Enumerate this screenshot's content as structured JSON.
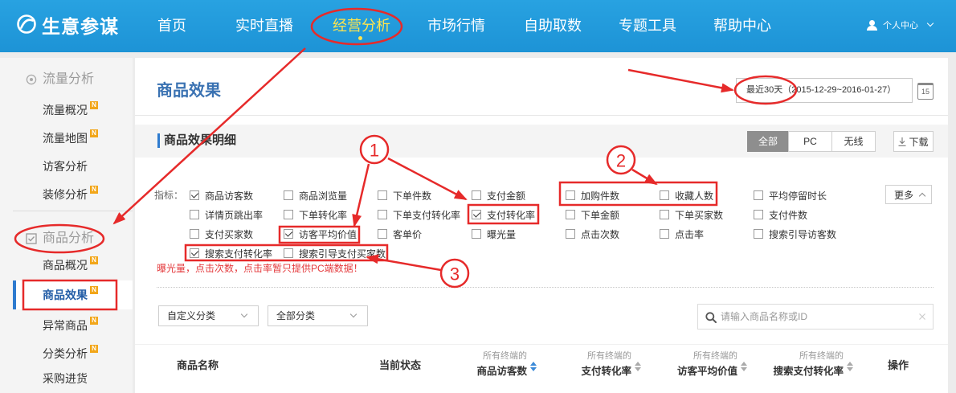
{
  "app": {
    "title": "生意参谋"
  },
  "nav": {
    "items": [
      {
        "label": "首页",
        "active": false
      },
      {
        "label": "实时直播",
        "active": false
      },
      {
        "label": "经营分析",
        "active": true
      },
      {
        "label": "市场行情",
        "active": false
      },
      {
        "label": "自助取数",
        "active": false
      },
      {
        "label": "专题工具",
        "active": false
      },
      {
        "label": "帮助中心",
        "active": false
      }
    ],
    "user_label": "个人中心",
    "icons": {
      "logo": "logo-icon",
      "user": "user-icon",
      "dropdown": "chevron-down-icon"
    }
  },
  "sidebar": {
    "sections": [
      {
        "title": "流量分析",
        "icon": "eye-icon",
        "items": [
          {
            "label": "流量概况",
            "badge": "N"
          },
          {
            "label": "流量地图",
            "badge": "N"
          },
          {
            "label": "访客分析"
          },
          {
            "label": "装修分析",
            "badge": "N"
          }
        ]
      },
      {
        "title": "商品分析",
        "icon": "checkbox-icon",
        "items": [
          {
            "label": "商品概况",
            "badge": "N"
          },
          {
            "label": "商品效果",
            "badge": "N",
            "active": true
          },
          {
            "label": "异常商品",
            "badge": "N"
          },
          {
            "label": "分类分析",
            "badge": "N"
          },
          {
            "label": "采购进货"
          }
        ]
      }
    ]
  },
  "main": {
    "title": "商品效果",
    "date_picker": {
      "preset": "最近30天",
      "range": "（2015-12-29~2016-01-27）",
      "calendar_day": "15"
    },
    "detail": {
      "title": "商品效果明细",
      "device_tabs": [
        {
          "label": "全部",
          "active": true
        },
        {
          "label": "PC",
          "active": false
        },
        {
          "label": "无线",
          "active": false
        }
      ],
      "download_label": "下载",
      "metrics_label": "指标：",
      "more_label": "更多",
      "metrics": [
        {
          "label": "商品访客数",
          "checked": true
        },
        {
          "label": "商品浏览量",
          "checked": false
        },
        {
          "label": "下单件数",
          "checked": false
        },
        {
          "label": "支付金额",
          "checked": false
        },
        {
          "label": "加购件数",
          "checked": false
        },
        {
          "label": "收藏人数",
          "checked": false
        },
        {
          "label": "平均停留时长",
          "checked": false
        },
        {
          "label": "详情页跳出率",
          "checked": false
        },
        {
          "label": "下单转化率",
          "checked": false
        },
        {
          "label": "下单支付转化率",
          "checked": false
        },
        {
          "label": "支付转化率",
          "checked": true
        },
        {
          "label": "下单金额",
          "checked": false
        },
        {
          "label": "下单买家数",
          "checked": false
        },
        {
          "label": "支付件数",
          "checked": false
        },
        {
          "label": "支付买家数",
          "checked": false
        },
        {
          "label": "访客平均价值",
          "checked": true
        },
        {
          "label": "客单价",
          "checked": false
        },
        {
          "label": "曝光量",
          "checked": false
        },
        {
          "label": "点击次数",
          "checked": false
        },
        {
          "label": "点击率",
          "checked": false
        },
        {
          "label": "搜索引导访客数",
          "checked": false
        },
        {
          "label": "搜索支付转化率",
          "checked": true
        },
        {
          "label": "搜索引导支付买家数",
          "checked": false
        }
      ],
      "note": "曝光量，点击次数，点击率暂只提供PC端数据！"
    },
    "filters": {
      "custom_category": "自定义分类",
      "all_category": "全部分类"
    },
    "search": {
      "placeholder": "请输入商品名称或ID",
      "value": ""
    },
    "table": {
      "columns": [
        {
          "label": "商品名称"
        },
        {
          "label": "当前状态"
        },
        {
          "prefix": "所有终端的",
          "label": "商品访客数",
          "sortable": true,
          "sort_active": true
        },
        {
          "prefix": "所有终端的",
          "label": "支付转化率",
          "sortable": true,
          "sort_active": false
        },
        {
          "prefix": "所有终端的",
          "label": "访客平均价值",
          "sortable": true,
          "sort_active": false
        },
        {
          "prefix": "所有终端的",
          "label": "搜索支付转化率",
          "sortable": true,
          "sort_active": false
        },
        {
          "label": "操作"
        }
      ]
    }
  },
  "annotations": {
    "markers": [
      "1",
      "2",
      "3"
    ]
  },
  "colors": {
    "nav_bar": "#239bdc",
    "nav_active": "#ffe44d",
    "accent_blue": "#2e7bcf",
    "title_blue": "#3a72b2",
    "badge": "#f2a619",
    "warning_red": "#e4393c",
    "annotation_red": "#e62a2a"
  }
}
